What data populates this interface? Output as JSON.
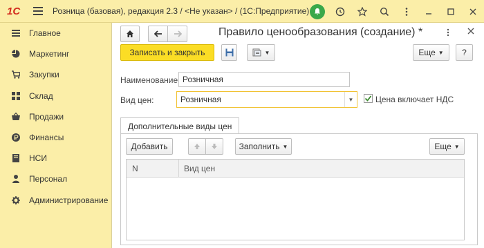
{
  "titlebar": {
    "logo": "1С",
    "title": "Розница (базовая), редакция 2.3 / <Не указан> / (1С:Предприятие)"
  },
  "sidebar": {
    "items": [
      {
        "label": "Главное",
        "icon": "list-icon"
      },
      {
        "label": "Маркетинг",
        "icon": "pie-chart-icon"
      },
      {
        "label": "Закупки",
        "icon": "cart-icon"
      },
      {
        "label": "Склад",
        "icon": "warehouse-icon"
      },
      {
        "label": "Продажи",
        "icon": "basket-icon"
      },
      {
        "label": "Финансы",
        "icon": "ruble-icon"
      },
      {
        "label": "НСИ",
        "icon": "book-icon"
      },
      {
        "label": "Персонал",
        "icon": "person-icon"
      },
      {
        "label": "Администрирование",
        "icon": "gear-icon"
      }
    ]
  },
  "form": {
    "title": "Правило ценообразования (создание) *",
    "save_close_label": "Записать и закрыть",
    "more_label": "Еще",
    "help_label": "?",
    "name_label": "Наименование:",
    "name_value": "Розничная",
    "price_type_label": "Вид цен:",
    "price_type_value": "Розничная",
    "vat_label": "Цена включает НДС",
    "vat_checked": true,
    "tab_label": "Дополнительные виды цен",
    "add_label": "Добавить",
    "fill_label": "Заполнить",
    "table_more_label": "Еще",
    "columns": [
      "N",
      "Вид цен"
    ]
  },
  "colors": {
    "accent": "#fbdd25",
    "sidebar_bg": "#fbeea8",
    "logo": "#d32b1e",
    "notification": "#3aa84a"
  }
}
